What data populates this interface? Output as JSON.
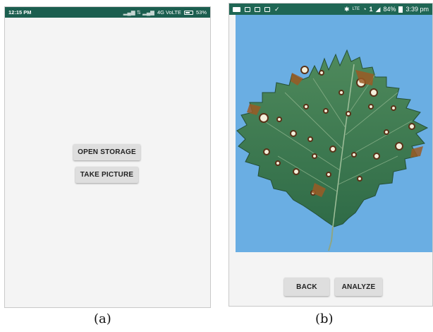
{
  "screen_a": {
    "status_bar": {
      "time": "12:15 PM",
      "network": "4G VoLTE",
      "battery": "53%"
    },
    "buttons": {
      "open_storage": "OPEN STORAGE",
      "take_picture": "TAKE PICTURE"
    },
    "caption": "(a)"
  },
  "screen_b": {
    "status_bar": {
      "lte": "LTE",
      "sim": "1",
      "battery": "84%",
      "time": "3:39 pm"
    },
    "buttons": {
      "back": "BACK",
      "analyze": "ANALYZE"
    },
    "caption": "(b)"
  },
  "colors": {
    "status_bar_a": "#1b5e4f",
    "status_bar_b": "#1f6654",
    "sky_blue": "#6aaee3",
    "leaf_green": "#3f7a4f",
    "button_grey": "#dedede"
  }
}
